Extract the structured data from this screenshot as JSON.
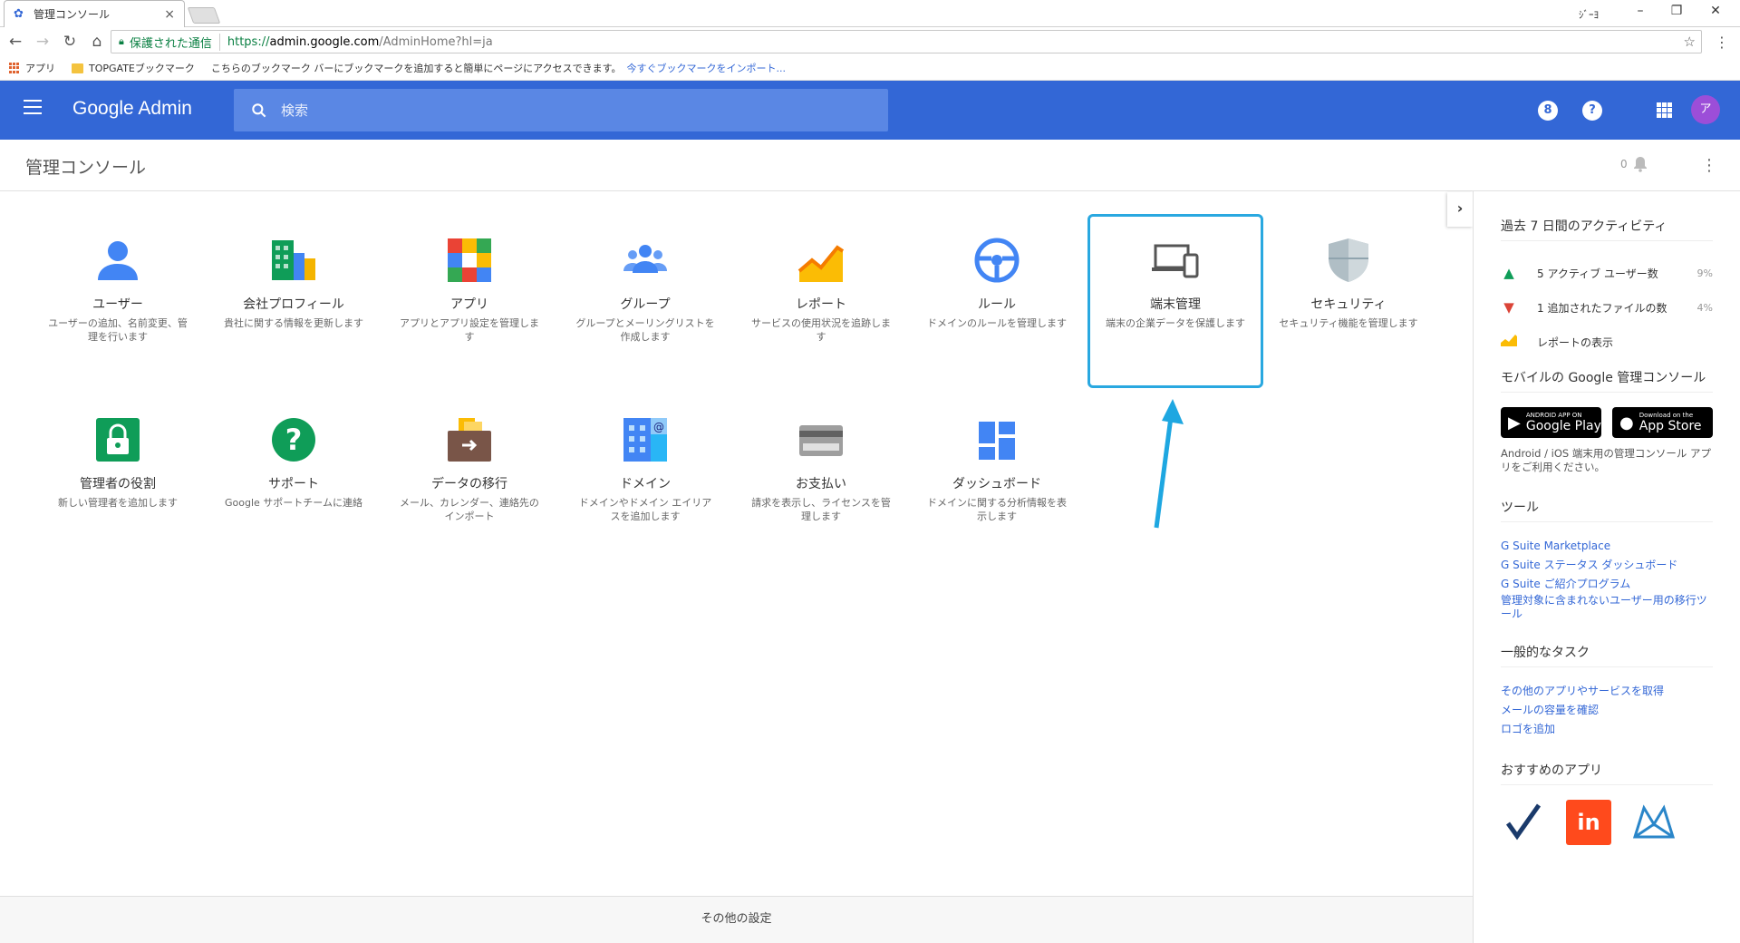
{
  "browser": {
    "tab_title": "管理コンソール",
    "tab_close": "×",
    "user_label": "ｼﾞｰﾖ",
    "secure_label": "保護された通信",
    "url_prefix": "https://",
    "url_domain": "admin.google.com",
    "url_path": "/AdminHome?hl=ja",
    "bookmarks": {
      "apps": "アプリ",
      "folder": "TOPGATEブックマーク",
      "hint": "こちらのブックマーク バーにブックマークを追加すると簡単にページにアクセスできます。",
      "import_link": "今すぐブックマークをインポート..."
    }
  },
  "header": {
    "brand": "Google Admin",
    "search_placeholder": "検索",
    "account_badge": "8",
    "help": "?",
    "avatar": "ア"
  },
  "page": {
    "title": "管理コンソール",
    "notification_count": "0"
  },
  "tiles": [
    {
      "id": "users",
      "name": "ユーザー",
      "desc": "ユーザーの追加、名前変更、管理を行います"
    },
    {
      "id": "company",
      "name": "会社プロフィール",
      "desc": "貴社に関する情報を更新します"
    },
    {
      "id": "apps",
      "name": "アプリ",
      "desc": "アプリとアプリ設定を管理します"
    },
    {
      "id": "groups",
      "name": "グループ",
      "desc": "グループとメーリングリストを作成します"
    },
    {
      "id": "reports",
      "name": "レポート",
      "desc": "サービスの使用状況を追跡します"
    },
    {
      "id": "rules",
      "name": "ルール",
      "desc": "ドメインのルールを管理します"
    },
    {
      "id": "devices",
      "name": "端末管理",
      "desc": "端末の企業データを保護します"
    },
    {
      "id": "security",
      "name": "セキュリティ",
      "desc": "セキュリティ機能を管理します"
    },
    {
      "id": "admin-roles",
      "name": "管理者の役割",
      "desc": "新しい管理者を追加します"
    },
    {
      "id": "support",
      "name": "サポート",
      "desc": "Google サポートチームに連絡"
    },
    {
      "id": "migration",
      "name": "データの移行",
      "desc": "メール、カレンダー、連絡先のインポート"
    },
    {
      "id": "domains",
      "name": "ドメイン",
      "desc": "ドメインやドメイン エイリアスを追加します"
    },
    {
      "id": "billing",
      "name": "お支払い",
      "desc": "請求を表示し、ライセンスを管理します"
    },
    {
      "id": "dashboard",
      "name": "ダッシュボード",
      "desc": "ドメインに関する分析情報を表示します"
    }
  ],
  "footer": {
    "label": "その他の設定"
  },
  "panel": {
    "activity_title": "過去 7 日間のアクティビティ",
    "activity": [
      {
        "text": "5  アクティブ ユーザー数",
        "pct": "9%",
        "color": "#0f9d58",
        "arrow": "▲"
      },
      {
        "text": "1  追加されたファイルの数",
        "pct": "4%",
        "color": "#db4437",
        "arrow": "▼"
      },
      {
        "text": "レポートの表示",
        "pct": "",
        "color": "#f4b400",
        "arrow": "~"
      }
    ],
    "mobile_title": "モバイルの Google 管理コンソール",
    "google_play_small": "ANDROID APP ON",
    "google_play_big": "Google Play",
    "app_store_small": "Download on the",
    "app_store_big": "App Store",
    "mobile_note": "Android / iOS 端末用の管理コンソール アプリをご利用ください。",
    "tools_title": "ツール",
    "tools": [
      "G Suite Marketplace",
      "G Suite ステータス ダッシュボード",
      "G Suite ご紹介プログラム",
      "管理対象に含まれないユーザー用の移行ツール"
    ],
    "tasks_title": "一般的なタスク",
    "tasks": [
      "その他のアプリやサービスを取得",
      "メールの容量を確認",
      "ロゴを追加"
    ],
    "recommended_title": "おすすめのアプリ",
    "recommended_invision": "in"
  }
}
